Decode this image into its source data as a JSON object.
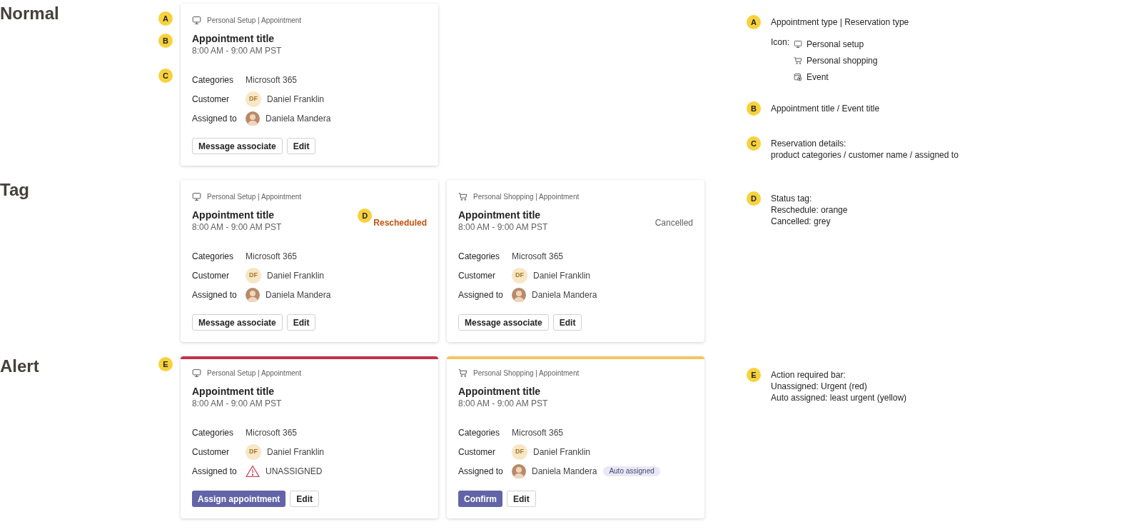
{
  "sections": [
    {
      "label": "Normal",
      "markers": [
        {
          "letter": "A",
          "kind": "header"
        },
        {
          "letter": "B",
          "kind": "title"
        },
        {
          "letter": "C",
          "kind": "details"
        }
      ],
      "cards": [
        {
          "kind": "monitor",
          "header": "Personal Setup | Appointment",
          "title": "Appointment title",
          "time": "8:00 AM - 9:00 AM PST",
          "details": [
            {
              "label": "Categories",
              "kind": "text",
              "value": "Microsoft 365"
            },
            {
              "label": "Customer",
              "kind": "initials",
              "initials": "DF",
              "value": "Daniel Franklin"
            },
            {
              "label": "Assigned to",
              "kind": "photo",
              "value": "Daniela Mandera"
            }
          ],
          "buttons": [
            {
              "label": "Message associate",
              "kind": "secondary"
            },
            {
              "label": "Edit",
              "kind": "secondary"
            }
          ]
        }
      ],
      "annotations": [
        {
          "letter": "A",
          "lines": [
            "Appointment type | Reservation type"
          ],
          "icon_label": "Icon:",
          "icons": [
            {
              "kind": "monitor",
              "label": "Personal setup"
            },
            {
              "kind": "cart",
              "label": "Personal shopping"
            },
            {
              "kind": "event",
              "label": "Event"
            }
          ]
        },
        {
          "letter": "B",
          "lines": [
            "Appointment title / Event title"
          ]
        },
        {
          "letter": "C",
          "lines": [
            "Reservation details:",
            "product categories / customer name / assigned to"
          ]
        }
      ]
    },
    {
      "label": "Tag",
      "cards": [
        {
          "kind": "monitor",
          "header": "Personal Setup | Appointment",
          "title": "Appointment title",
          "time": "8:00 AM - 9:00 AM PST",
          "status": {
            "text": "Rescheduled",
            "kind": "orange",
            "marker": "D"
          },
          "details": [
            {
              "label": "Categories",
              "kind": "text",
              "value": "Microsoft 365"
            },
            {
              "label": "Customer",
              "kind": "initials",
              "initials": "DF",
              "value": "Daniel Franklin"
            },
            {
              "label": "Assigned to",
              "kind": "photo",
              "value": "Daniela Mandera"
            }
          ],
          "buttons": [
            {
              "label": "Message associate",
              "kind": "secondary"
            },
            {
              "label": "Edit",
              "kind": "secondary"
            }
          ]
        },
        {
          "kind": "cart",
          "header": "Personal Shopping | Appointment",
          "title": "Appointment title",
          "time": "8:00 AM - 9:00 AM PST",
          "status": {
            "text": "Cancelled",
            "kind": "grey"
          },
          "details": [
            {
              "label": "Categories",
              "kind": "text",
              "value": "Microsoft 365"
            },
            {
              "label": "Customer",
              "kind": "initials",
              "initials": "DF",
              "value": "Daniel Franklin"
            },
            {
              "label": "Assigned to",
              "kind": "photo",
              "value": "Daniela Mandera"
            }
          ],
          "buttons": [
            {
              "label": "Message associate",
              "kind": "secondary"
            },
            {
              "label": "Edit",
              "kind": "secondary"
            }
          ]
        }
      ],
      "annotations": [
        {
          "letter": "D",
          "lines": [
            "Status tag:",
            "Reschedule: orange",
            "Cancelled: grey"
          ]
        }
      ]
    },
    {
      "label": "Alert",
      "markers": [
        {
          "letter": "E",
          "kind": "bar"
        }
      ],
      "cards": [
        {
          "kind": "monitor",
          "color": "#c4314b",
          "header": "Personal Setup | Appointment",
          "title": "Appointment title",
          "time": "8:00 AM - 9:00 AM PST",
          "details": [
            {
              "label": "Categories",
              "kind": "text",
              "value": "Microsoft 365"
            },
            {
              "label": "Customer",
              "kind": "initials",
              "initials": "DF",
              "value": "Daniel Franklin"
            },
            {
              "label": "Assigned to",
              "kind": "unassigned",
              "value": "UNASSIGNED"
            }
          ],
          "buttons": [
            {
              "label": "Assign appointment",
              "kind": "primary"
            },
            {
              "label": "Edit",
              "kind": "secondary"
            }
          ]
        },
        {
          "kind": "cart",
          "color": "#f2c661",
          "header": "Personal Shopping | Appointment",
          "title": "Appointment title",
          "time": "8:00 AM - 9:00 AM PST",
          "details": [
            {
              "label": "Categories",
              "kind": "text",
              "value": "Microsoft 365"
            },
            {
              "label": "Customer",
              "kind": "initials",
              "initials": "DF",
              "value": "Daniel Franklin"
            },
            {
              "label": "Assigned to",
              "kind": "photo",
              "value": "Daniela Mandera",
              "badge": "Auto assigned"
            }
          ],
          "buttons": [
            {
              "label": "Confirm",
              "kind": "primary"
            },
            {
              "label": "Edit",
              "kind": "secondary"
            }
          ]
        }
      ],
      "annotations": [
        {
          "letter": "E",
          "lines": [
            "Action required bar:",
            "Unassigned: Urgent (red)",
            "Auto assigned: least urgent (yellow)"
          ]
        }
      ]
    }
  ]
}
